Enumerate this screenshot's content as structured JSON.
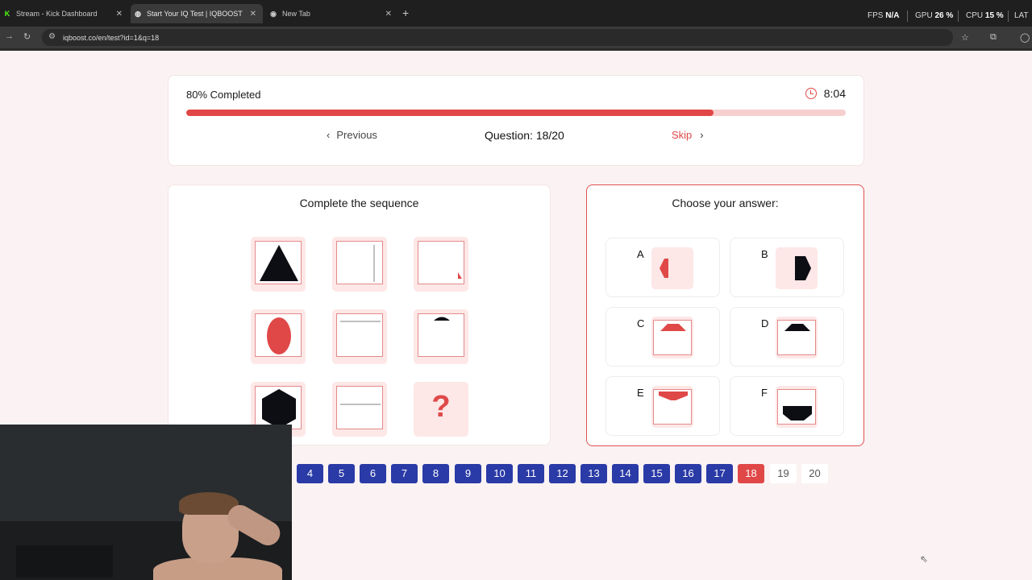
{
  "browser": {
    "tabs": [
      {
        "title": "Stream - Kick Dashboard",
        "icon": "K",
        "active": false
      },
      {
        "title": "Start Your IQ Test | IQBOOST",
        "icon": "globe",
        "active": true
      },
      {
        "title": "New Tab",
        "icon": "chrome",
        "active": false
      }
    ],
    "new_tab_symbol": "+",
    "url": "iqboost.co/en/test?id=1&q=18",
    "hud": {
      "fps_label": "FPS",
      "fps_value": "N/A",
      "gpu_label": "GPU",
      "gpu_value": "26 %",
      "cpu_label": "CPU",
      "cpu_value": "15 %",
      "lat_label": "LAT"
    }
  },
  "progress": {
    "label": "80% Completed",
    "percent": 80,
    "timer": "8:04"
  },
  "navigation": {
    "previous_label": "Previous",
    "question_label": "Question: 18/20",
    "skip_label": "Skip"
  },
  "sequence": {
    "title": "Complete the sequence",
    "question_mark": "?"
  },
  "answers": {
    "title": "Choose your answer:",
    "options": [
      {
        "letter": "A"
      },
      {
        "letter": "B"
      },
      {
        "letter": "C"
      },
      {
        "letter": "D"
      },
      {
        "letter": "E"
      },
      {
        "letter": "F"
      }
    ]
  },
  "question_nav": {
    "numbers": [
      "4",
      "5",
      "6",
      "7",
      "8",
      "9",
      "10",
      "11",
      "12",
      "13",
      "14",
      "15",
      "16",
      "17",
      "18",
      "19",
      "20"
    ],
    "current": "18"
  },
  "colors": {
    "accent_red": "#e04848",
    "nav_blue": "#2a3aa6",
    "shape_black": "#0d0d14"
  }
}
